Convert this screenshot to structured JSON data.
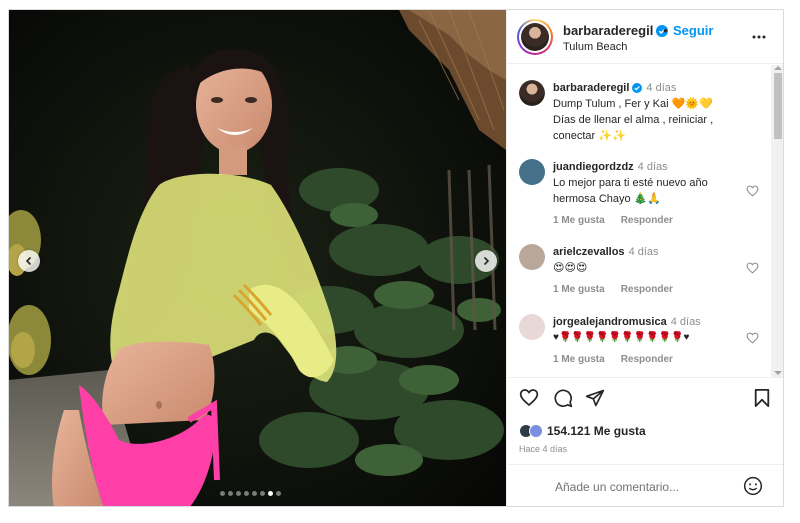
{
  "media": {
    "dots_total": 8,
    "dots_active": 7
  },
  "header": {
    "username": "barbaraderegil",
    "separator": "•",
    "follow_label": "Seguir",
    "location": "Tulum Beach",
    "more_icon": "more-horizontal-icon"
  },
  "caption": {
    "username": "barbaraderegil",
    "time": "4 días",
    "lines": [
      "Dump Tulum , Fer y Kai 🧡🌞💛",
      "Días de llenar el alma , reiniciar ,",
      "conectar ✨✨"
    ]
  },
  "comments": [
    {
      "username": "juandiegordzdz",
      "time": "4 días",
      "lines": [
        "Lo mejor para ti esté nuevo año",
        "hermosa Chayo 🎄🙏"
      ],
      "likes_label": "1 Me gusta",
      "reply_label": "Responder"
    },
    {
      "username": "arielczevallos",
      "time": "4 días",
      "lines": [
        "😍😍😍"
      ],
      "likes_label": "1 Me gusta",
      "reply_label": "Responder"
    },
    {
      "username": "jorgealejandromusica",
      "time": "4 días",
      "lines": [
        "♥🌹🌹🌹🌹🌹🌹🌹🌹🌹🌹♥"
      ],
      "likes_label": "1 Me gusta",
      "reply_label": "Responder"
    }
  ],
  "actions": {
    "likes": "154.121 Me gusta",
    "ago": "Hace 4 días"
  },
  "add_comment": {
    "placeholder": "Añade un comentario...",
    "emoji_icon": "smiley-icon"
  },
  "colors": {
    "accent": "#0095f6",
    "verified": "#0095f6",
    "bikini": "#ff3fa8",
    "top": "#e8ec86"
  }
}
